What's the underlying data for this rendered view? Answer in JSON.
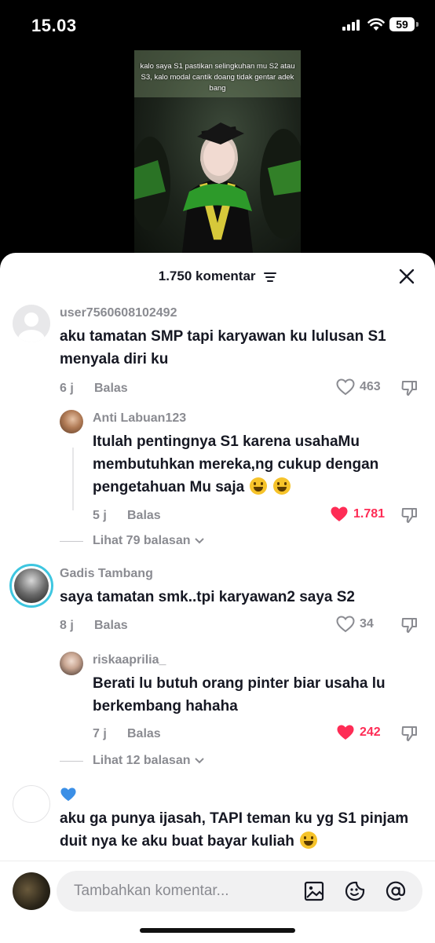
{
  "status_bar": {
    "time": "15.03",
    "battery": "59"
  },
  "video": {
    "caption": "kalo saya S1 pastikan selingkuhan mu S2 atau S3, kalo modal cantik doang tidak gentar adek bang"
  },
  "sheet": {
    "title": "1.750 komentar"
  },
  "comments": [
    {
      "username": "user7560608102492",
      "text": "aku tamatan SMP tapi karyawan ku lulusan S1 menyala diri ku",
      "time": "6 j",
      "reply_label": "Balas",
      "likes": "463",
      "liked": false
    },
    {
      "username": "Anti Labuan123",
      "text": "Itulah pentingnya S1 karena usahaMu membutuhkan mereka,ng cukup dengan pengetahuan Mu saja",
      "time": "5 j",
      "reply_label": "Balas",
      "likes": "1.781",
      "liked": true,
      "view_replies": "Lihat 79 balasan"
    },
    {
      "username": "Gadis Tambang",
      "text": "saya tamatan smk..tpi karyawan2 saya S2",
      "time": "8 j",
      "reply_label": "Balas",
      "likes": "34",
      "liked": false
    },
    {
      "username": "riskaaprilia_",
      "text": "Berati lu butuh orang pinter biar usaha lu berkembang hahaha",
      "time": "7 j",
      "reply_label": "Balas",
      "likes": "242",
      "liked": true,
      "view_replies": "Lihat 12 balasan"
    },
    {
      "username": "",
      "text": "aku ga punya ijasah, TAPI teman ku yg S1 pinjam duit nya ke aku buat bayar kuliah"
    }
  ],
  "input": {
    "placeholder": "Tambahkan komentar..."
  },
  "colors": {
    "accent_like": "#fe2c55",
    "muted": "#8a8b91",
    "text": "#161823"
  }
}
